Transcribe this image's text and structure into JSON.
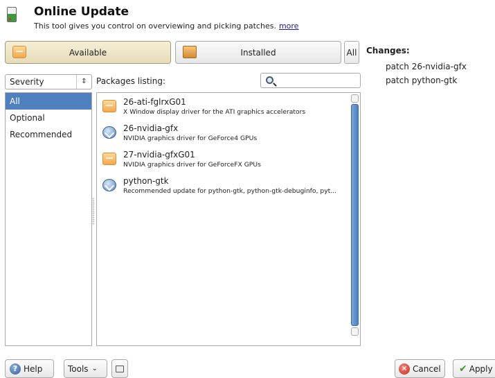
{
  "header": {
    "title": "Online Update",
    "description": "This tool gives you control on overviewing and picking patches.",
    "more_link": "more"
  },
  "view_buttons": {
    "available": "Available",
    "installed": "Installed",
    "all": "All"
  },
  "filter": {
    "severity_value": "Severity",
    "severity_options": [
      "All",
      "Optional",
      "Recommended"
    ],
    "selected_severity": "All"
  },
  "packages": {
    "label": "Packages listing:",
    "search_placeholder": "",
    "items": [
      {
        "name": "26-ati-fglrxG01",
        "description": "X Window display driver for the ATI graphics accelerators",
        "icon": "package-icon"
      },
      {
        "name": "26-nvidia-gfx",
        "description": "NVIDIA graphics driver for GeForce4 GPUs",
        "icon": "update-icon"
      },
      {
        "name": "27-nvidia-gfxG01",
        "description": "NVIDIA graphics driver for GeForceFX GPUs",
        "icon": "package-icon"
      },
      {
        "name": "python-gtk",
        "description": "Recommended update for python-gtk, python-gtk-debuginfo, pyt...",
        "icon": "update-icon"
      }
    ]
  },
  "changes": {
    "title": "Changes:",
    "items": [
      "patch 26-nvidia-gfx",
      "patch python-gtk"
    ]
  },
  "footer": {
    "help": "Help",
    "tools": "Tools",
    "cancel": "Cancel",
    "apply": "Apply"
  },
  "colors": {
    "selection": "#4e81bd",
    "link": "#1a1aa6",
    "active_button": "#f6efd8"
  }
}
